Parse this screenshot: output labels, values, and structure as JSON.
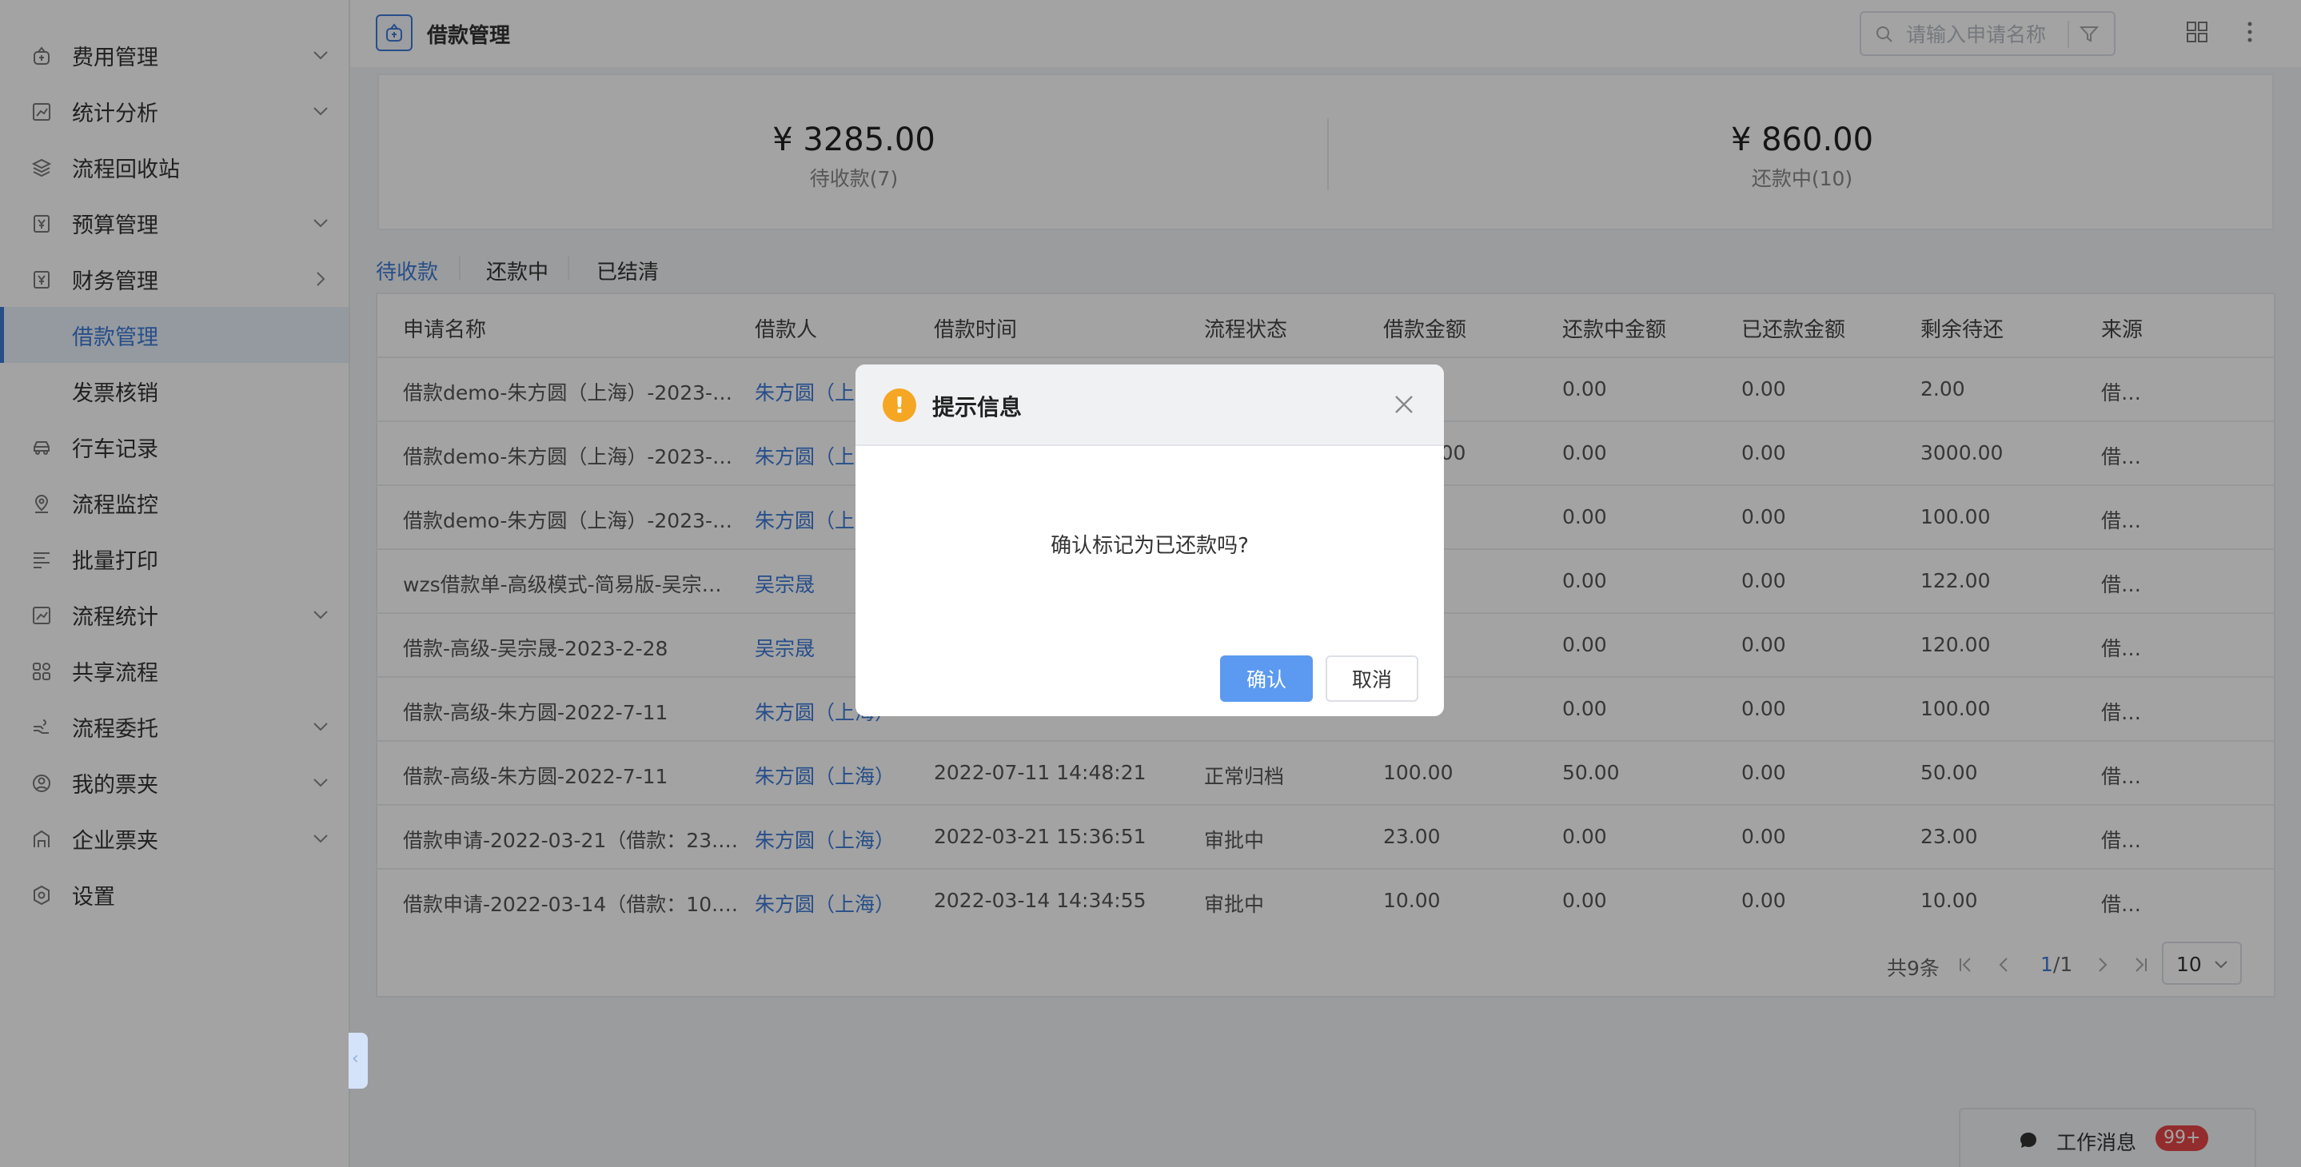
{
  "sidebar": {
    "items": [
      {
        "label": "费用管理",
        "icon": "wallet-icon",
        "chevron": "down"
      },
      {
        "label": "统计分析",
        "icon": "chart-icon",
        "chevron": "down"
      },
      {
        "label": "流程回收站",
        "icon": "stack-icon",
        "chevron": ""
      },
      {
        "label": "预算管理",
        "icon": "yen-doc-icon",
        "chevron": "down"
      },
      {
        "label": "财务管理",
        "icon": "yen-doc-icon",
        "chevron": "right"
      },
      {
        "label": "借款管理",
        "icon": "",
        "chevron": "",
        "active": true
      },
      {
        "label": "发票核销",
        "icon": "",
        "chevron": ""
      },
      {
        "label": "行车记录",
        "icon": "car-icon",
        "chevron": ""
      },
      {
        "label": "流程监控",
        "icon": "location-icon",
        "chevron": ""
      },
      {
        "label": "批量打印",
        "icon": "list-icon",
        "chevron": ""
      },
      {
        "label": "流程统计",
        "icon": "chart-icon",
        "chevron": "down"
      },
      {
        "label": "共享流程",
        "icon": "share-icon",
        "chevron": ""
      },
      {
        "label": "流程委托",
        "icon": "hand-icon",
        "chevron": "down"
      },
      {
        "label": "我的票夹",
        "icon": "user-circle-icon",
        "chevron": "down"
      },
      {
        "label": "企业票夹",
        "icon": "building-icon",
        "chevron": "down"
      },
      {
        "label": "设置",
        "icon": "gear-icon",
        "chevron": ""
      }
    ]
  },
  "header": {
    "title": "借款管理",
    "search_placeholder": "请输入申请名称"
  },
  "summary": {
    "pending_amount": "¥ 3285.00",
    "pending_label": "待收款(7)",
    "repaying_amount": "¥ 860.00",
    "repaying_label": "还款中(10)"
  },
  "tabs": [
    {
      "label": "待收款",
      "active": true
    },
    {
      "label": "还款中",
      "active": false
    },
    {
      "label": "已结清",
      "active": false
    }
  ],
  "table": {
    "headers": [
      "申请名称",
      "借款人",
      "借款时间",
      "流程状态",
      "借款金额",
      "还款中金额",
      "已还款金额",
      "剩余待还",
      "来源"
    ],
    "rows": [
      [
        "借款demo-朱方圆（上海）-2023-…",
        "朱方圆（上海）",
        "",
        "",
        "",
        "0.00",
        "0.00",
        "2.00",
        "借…"
      ],
      [
        "借款demo-朱方圆（上海）-2023-…",
        "朱方圆（上海）",
        "",
        "",
        "3000.00",
        "0.00",
        "0.00",
        "3000.00",
        "借…"
      ],
      [
        "借款demo-朱方圆（上海）-2023-…",
        "朱方圆（上海）",
        "",
        "",
        "",
        "0.00",
        "0.00",
        "100.00",
        "借…"
      ],
      [
        "wzs借款单-高级模式-简易版-吴宗…",
        "吴宗晟",
        "",
        "",
        "",
        "0.00",
        "0.00",
        "122.00",
        "借…"
      ],
      [
        "借款-高级-吴宗晟-2023-2-28",
        "吴宗晟",
        "",
        "",
        "",
        "0.00",
        "0.00",
        "120.00",
        "借…"
      ],
      [
        "借款-高级-朱方圆-2022-7-11",
        "朱方圆（上海）",
        "",
        "",
        "",
        "0.00",
        "0.00",
        "100.00",
        "借…"
      ],
      [
        "借款-高级-朱方圆-2022-7-11",
        "朱方圆（上海）",
        "2022-07-11 14:48:21",
        "正常归档",
        "100.00",
        "50.00",
        "0.00",
        "50.00",
        "借…"
      ],
      [
        "借款申请-2022-03-21（借款：23.…",
        "朱方圆（上海）",
        "2022-03-21 15:36:51",
        "审批中",
        "23.00",
        "0.00",
        "0.00",
        "23.00",
        "借…"
      ],
      [
        "借款申请-2022-03-14（借款：10.…",
        "朱方圆（上海）",
        "2022-03-14 14:34:55",
        "审批中",
        "10.00",
        "0.00",
        "0.00",
        "10.00",
        "借…"
      ]
    ]
  },
  "pager": {
    "total": "共9条",
    "current": "1",
    "pages": "/1",
    "page_size": "10"
  },
  "modal": {
    "title": "提示信息",
    "message": "确认标记为已还款吗?",
    "confirm": "确认",
    "cancel": "取消"
  },
  "work_message": {
    "label": "工作消息",
    "badge": "99+"
  },
  "colors": {
    "accent": "#3d7ad6",
    "confirm_button": "#5b9af0",
    "warning": "#f5a623",
    "badge": "#e64545"
  }
}
